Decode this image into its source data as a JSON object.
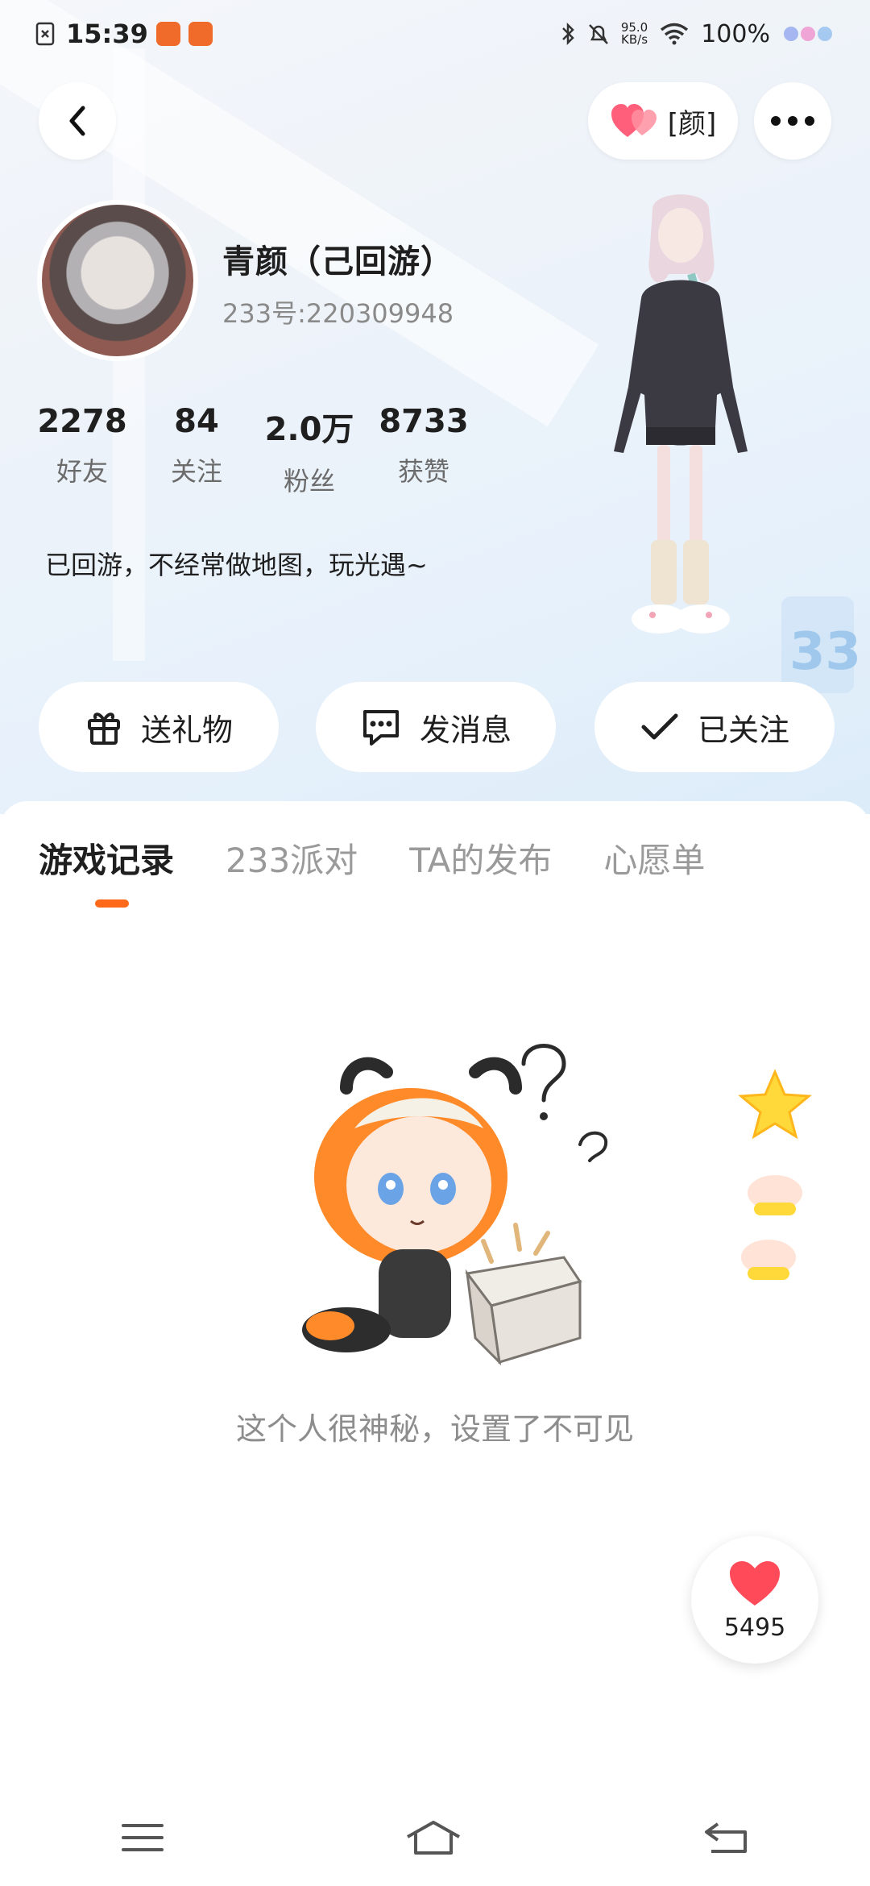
{
  "status_bar": {
    "time": "15:39",
    "net_speed_value": "95.0",
    "net_speed_unit": "KB/s",
    "battery": "100%"
  },
  "header": {
    "pill_label": "[颜]"
  },
  "profile": {
    "name": "青颜（己回游）",
    "uid": "233号:220309948",
    "bio": "已回游，不经常做地图，玩光遇~"
  },
  "stats": [
    {
      "value": "2278",
      "label": "好友"
    },
    {
      "value": "84",
      "label": "关注"
    },
    {
      "value": "2.0万",
      "label": "粉丝"
    },
    {
      "value": "8733",
      "label": "获赞"
    }
  ],
  "actions": {
    "gift": "送礼物",
    "message": "发消息",
    "followed": "已关注"
  },
  "tabs": [
    {
      "label": "游戏记录"
    },
    {
      "label": "233派对"
    },
    {
      "label": "TA的发布"
    },
    {
      "label": "心愿单"
    }
  ],
  "empty_state": {
    "text": "这个人很神秘，设置了不可见"
  },
  "like": {
    "count": "5495"
  },
  "colors": {
    "accent": "#ff6a1a",
    "heart": "#ff4a5a"
  }
}
